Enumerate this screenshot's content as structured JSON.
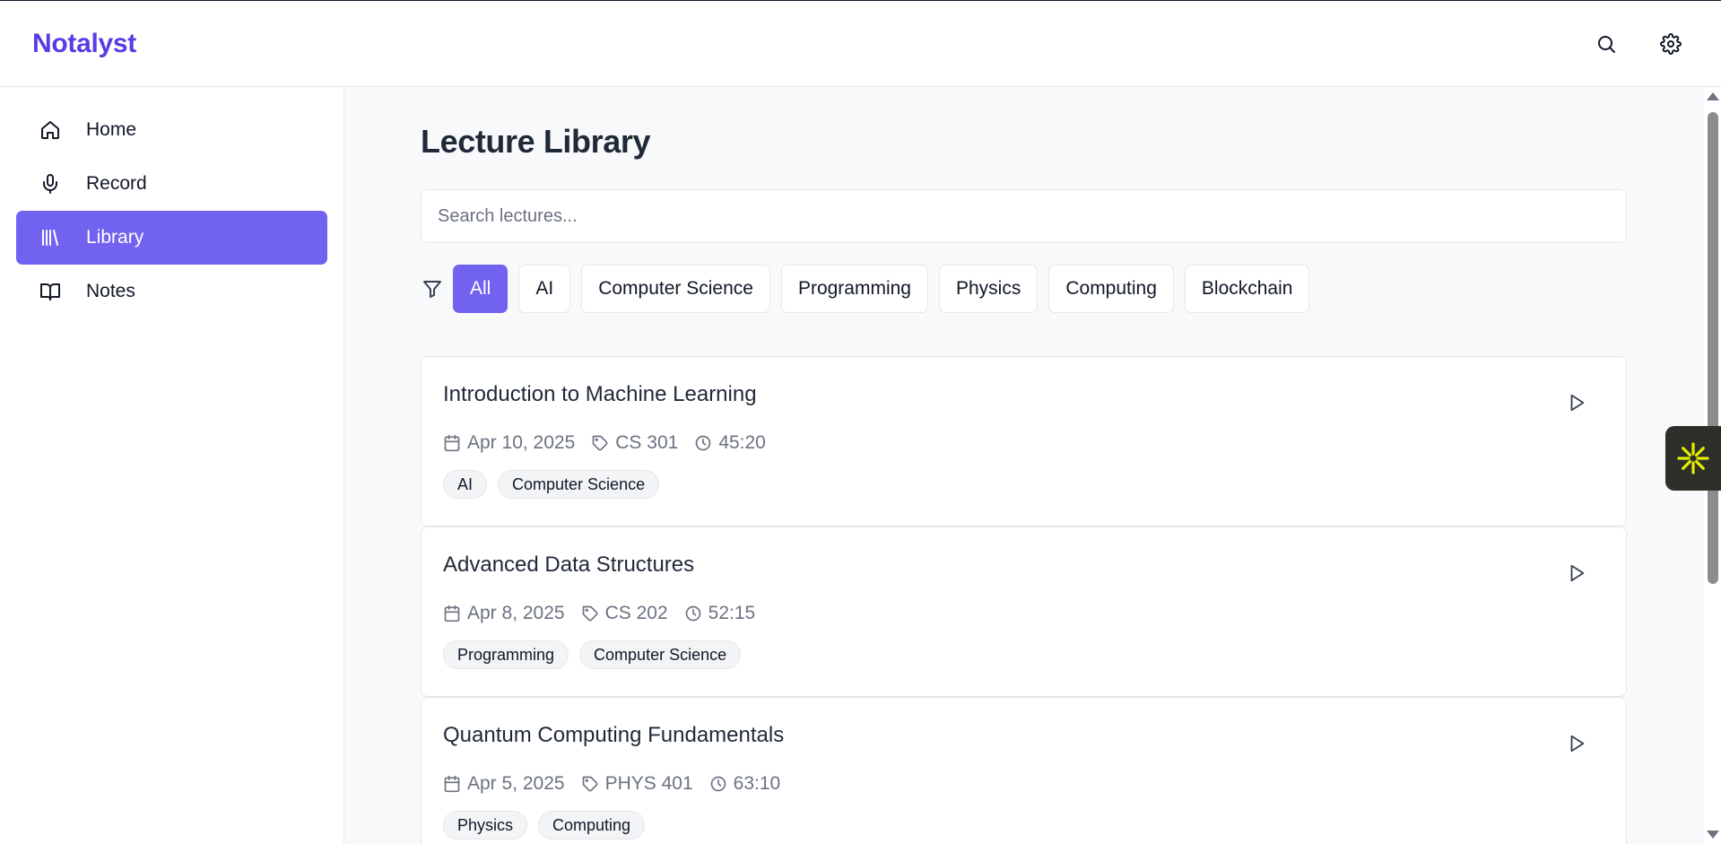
{
  "app": {
    "name": "Notalyst"
  },
  "header": {
    "icons": [
      "search-icon",
      "gear-icon"
    ]
  },
  "sidebar": {
    "items": [
      {
        "label": "Home",
        "icon": "home-icon",
        "active": false
      },
      {
        "label": "Record",
        "icon": "microphone-icon",
        "active": false
      },
      {
        "label": "Library",
        "icon": "library-icon",
        "active": true
      },
      {
        "label": "Notes",
        "icon": "book-icon",
        "active": false
      }
    ]
  },
  "main": {
    "title": "Lecture Library",
    "search": {
      "placeholder": "Search lectures...",
      "value": ""
    },
    "filters": {
      "icon": "filter-icon",
      "options": [
        "All",
        "AI",
        "Computer Science",
        "Programming",
        "Physics",
        "Computing",
        "Blockchain"
      ],
      "selected": "All"
    },
    "lectures": [
      {
        "title": "Introduction to Machine Learning",
        "date": "Apr 10, 2025",
        "course": "CS 301",
        "duration": "45:20",
        "tags": [
          "AI",
          "Computer Science"
        ]
      },
      {
        "title": "Advanced Data Structures",
        "date": "Apr 8, 2025",
        "course": "CS 202",
        "duration": "52:15",
        "tags": [
          "Programming",
          "Computer Science"
        ]
      },
      {
        "title": "Quantum Computing Fundamentals",
        "date": "Apr 5, 2025",
        "course": "PHYS 401",
        "duration": "63:10",
        "tags": [
          "Physics",
          "Computing"
        ]
      }
    ]
  },
  "colors": {
    "brand": "#5b3be6",
    "accent": "#7163f0",
    "widget": "#2f2f2a",
    "widget_icon": "#e4f000"
  },
  "widget": {
    "icon": "sparkle-icon"
  }
}
